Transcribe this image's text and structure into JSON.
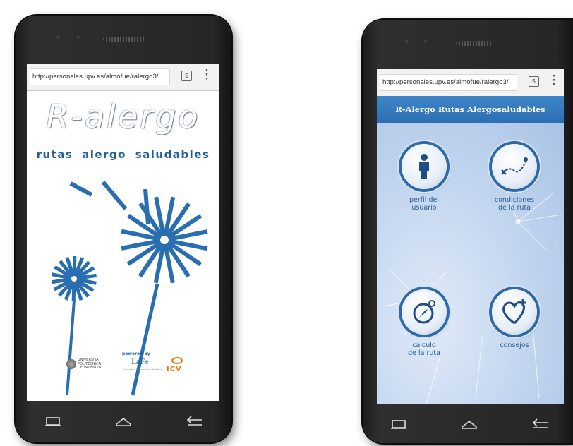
{
  "phone1": {
    "browser": {
      "url": "http://personales.upv.es/almofue/ralergo3/",
      "tabs_count": "5"
    },
    "splash": {
      "title": "R-alergo",
      "subtitle": "rutas alergo saludables",
      "powered_by": "powered by",
      "logos": {
        "upv": "UNIVERSITAT\nPOLITÈCNICA\nDE VALÈNCIA",
        "lafe": "LaFe",
        "lafe_sub": "Hospital Universitari i Politècnic",
        "icv": "ICV"
      }
    }
  },
  "phone2": {
    "browser": {
      "url": "http://personales.upv.es/almofue/ralergo3/",
      "tabs_count": "5"
    },
    "app": {
      "header_title": "R-Alergo Rutas Alergosaludables",
      "tiles": [
        {
          "label": "perfil del\nusuario",
          "icon": "person-icon"
        },
        {
          "label": "condiciones\nde la ruta",
          "icon": "route-map-icon"
        },
        {
          "label": "cálculo\nde la ruta",
          "icon": "compass-icon"
        },
        {
          "label": "consejos",
          "icon": "heart-plus-icon"
        }
      ]
    }
  },
  "colors": {
    "brand_blue": "#1f5f9e",
    "header_blue": "#2f74b8",
    "icv_orange": "#e07a10"
  }
}
